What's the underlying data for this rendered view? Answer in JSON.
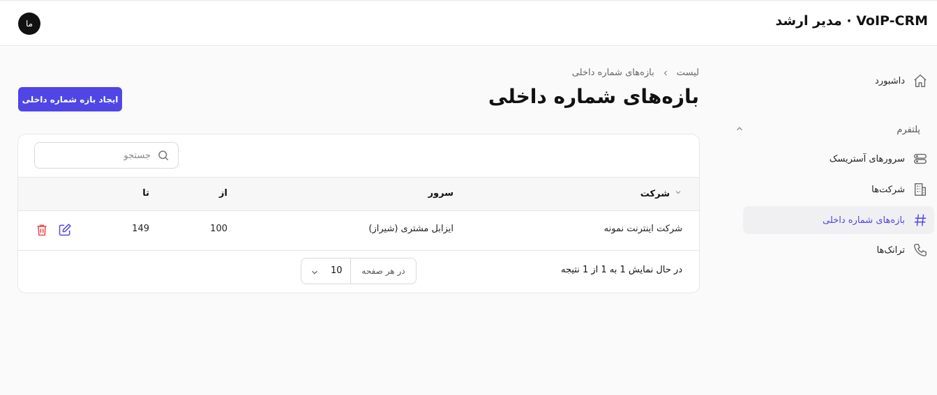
{
  "header": {
    "brand": "VoIP-CRM · مدیر ارشد",
    "avatar_text": "ما"
  },
  "sidebar": {
    "dashboard": {
      "label": "داشبورد",
      "icon": "home-icon"
    },
    "section": {
      "label": "پلتفرم",
      "icon": "chevron-up-icon"
    },
    "items": [
      {
        "label": "سرورهای آستریسک",
        "icon": "server-icon"
      },
      {
        "label": "شرکت‌ها",
        "icon": "building-icon"
      },
      {
        "label": "بازه‌های شماره داخلی",
        "icon": "hash-icon",
        "active": true
      },
      {
        "label": "ترانک‌ها",
        "icon": "phone-icon"
      }
    ]
  },
  "breadcrumb": {
    "parent": "بازه‌های شماره داخلی",
    "current": "لیست"
  },
  "page": {
    "title": "بازه‌های شماره داخلی",
    "create_button": "ایجاد بازه شماره داخلی"
  },
  "search": {
    "placeholder": "جستجو",
    "value": ""
  },
  "table": {
    "columns": {
      "company": "شرکت",
      "server": "سرور",
      "from": "از",
      "to": "تا"
    },
    "rows": [
      {
        "company": "شرکت اینترنت نمونه",
        "server": "ایزابل مشتری (شیراز)",
        "from": "100",
        "to": "149"
      }
    ]
  },
  "footer": {
    "result_text": "در حال نمایش 1 به 1 از 1 نتیجه",
    "per_page_label": "در هر صفحه",
    "per_page_value": "10"
  },
  "colors": {
    "accent": "#4f46e5",
    "danger": "#ef4444"
  }
}
